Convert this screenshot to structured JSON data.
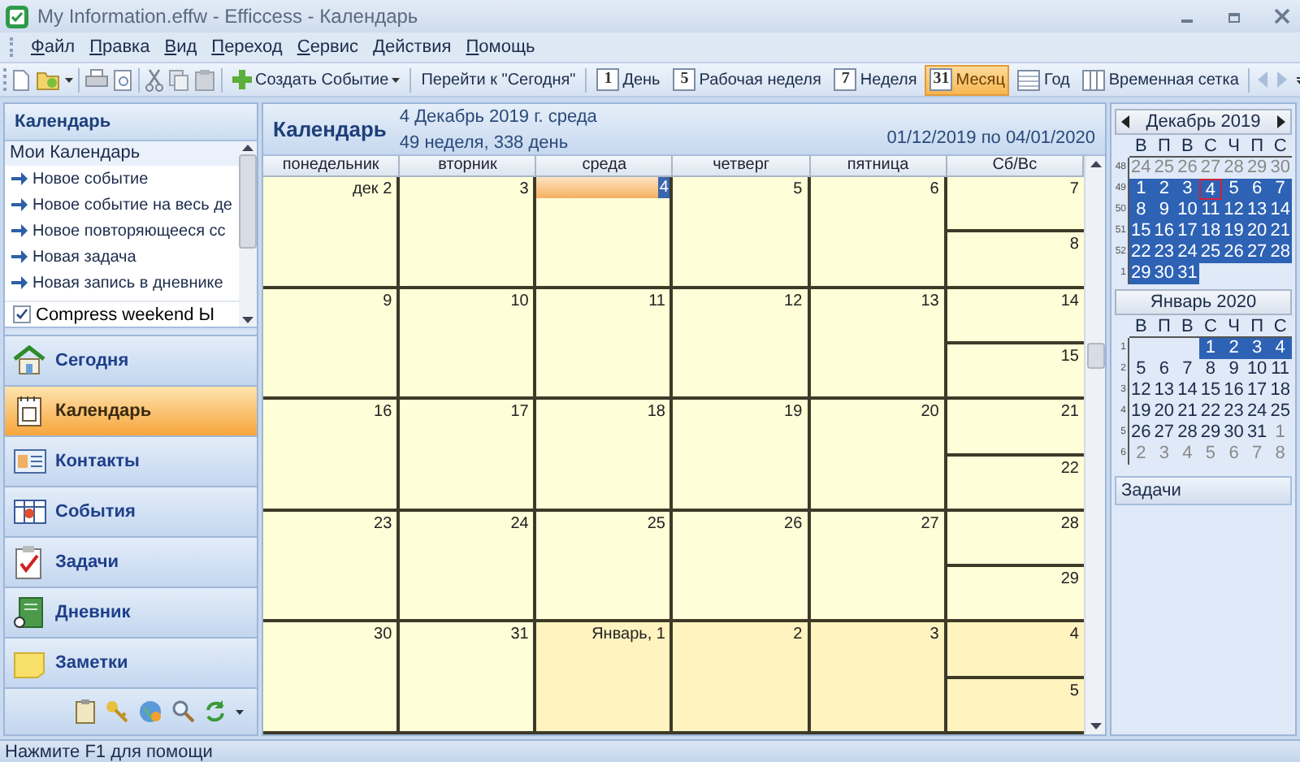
{
  "window": {
    "title": "My Information.effw - Efficcess - Календарь"
  },
  "menu": [
    "Файл",
    "Правка",
    "Вид",
    "Переход",
    "Сервис",
    "Действия",
    "Помощь"
  ],
  "toolbar": {
    "create_button": "Создать Событие",
    "today_button": "Перейти к \"Сегодня\"",
    "views": [
      {
        "label": "День",
        "icon_text": "1",
        "selected": false
      },
      {
        "label": "Рабочая неделя",
        "icon_text": "5",
        "selected": false
      },
      {
        "label": "Неделя",
        "icon_text": "7",
        "selected": false
      },
      {
        "label": "Месяц",
        "icon_text": "31",
        "selected": true
      },
      {
        "label": "Год",
        "selected": false
      },
      {
        "label": "Временная сетка",
        "selected": false
      }
    ]
  },
  "sidebar": {
    "title": "Календарь",
    "list_title": "Мои Календарь",
    "actions": [
      "Новое событие",
      "Новое событие на весь де",
      "Новое повторяющееся сс",
      "Новая задача",
      "Новая запись в дневнике"
    ],
    "option": {
      "label": "Compress weekend Ы",
      "checked": true
    },
    "nav": [
      {
        "label": "Сегодня",
        "kind": "home",
        "selected": false
      },
      {
        "label": "Календарь",
        "kind": "calendar",
        "selected": true
      },
      {
        "label": "Контакты",
        "kind": "contacts",
        "selected": false
      },
      {
        "label": "События",
        "kind": "events",
        "selected": false
      },
      {
        "label": "Задачи",
        "kind": "tasks",
        "selected": false
      },
      {
        "label": "Дневник",
        "kind": "diary",
        "selected": false
      },
      {
        "label": "Заметки",
        "kind": "notes",
        "selected": false
      }
    ]
  },
  "calendar": {
    "title": "Календарь",
    "date_line": "4 Декабрь 2019 г. среда",
    "week_line": "49 неделя, 338 день",
    "range": "01/12/2019 по 04/01/2020",
    "columns": [
      "понедельник",
      "вторник",
      "среда",
      "четверг",
      "пятница",
      "Сб/Вс"
    ],
    "weeks": [
      {
        "days": [
          {
            "label": "дек 2",
            "selected": false,
            "next_month": false
          },
          {
            "label": "3",
            "selected": false,
            "next_month": false
          },
          {
            "label": "4",
            "selected": true,
            "next_month": false
          },
          {
            "label": "5",
            "selected": false,
            "next_month": false
          },
          {
            "label": "6",
            "selected": false,
            "next_month": false
          }
        ],
        "weekend": [
          {
            "label": "7",
            "selected": false,
            "next_month": false
          },
          {
            "label": "8",
            "selected": false,
            "next_month": false
          }
        ]
      },
      {
        "days": [
          {
            "label": "9",
            "selected": false,
            "next_month": false
          },
          {
            "label": "10",
            "selected": false,
            "next_month": false
          },
          {
            "label": "11",
            "selected": false,
            "next_month": false
          },
          {
            "label": "12",
            "selected": false,
            "next_month": false
          },
          {
            "label": "13",
            "selected": false,
            "next_month": false
          }
        ],
        "weekend": [
          {
            "label": "14",
            "selected": false,
            "next_month": false
          },
          {
            "label": "15",
            "selected": false,
            "next_month": false
          }
        ]
      },
      {
        "days": [
          {
            "label": "16",
            "selected": false,
            "next_month": false
          },
          {
            "label": "17",
            "selected": false,
            "next_month": false
          },
          {
            "label": "18",
            "selected": false,
            "next_month": false
          },
          {
            "label": "19",
            "selected": false,
            "next_month": false
          },
          {
            "label": "20",
            "selected": false,
            "next_month": false
          }
        ],
        "weekend": [
          {
            "label": "21",
            "selected": false,
            "next_month": false
          },
          {
            "label": "22",
            "selected": false,
            "next_month": false
          }
        ]
      },
      {
        "days": [
          {
            "label": "23",
            "selected": false,
            "next_month": false
          },
          {
            "label": "24",
            "selected": false,
            "next_month": false
          },
          {
            "label": "25",
            "selected": false,
            "next_month": false
          },
          {
            "label": "26",
            "selected": false,
            "next_month": false
          },
          {
            "label": "27",
            "selected": false,
            "next_month": false
          }
        ],
        "weekend": [
          {
            "label": "28",
            "selected": false,
            "next_month": false
          },
          {
            "label": "29",
            "selected": false,
            "next_month": false
          }
        ]
      },
      {
        "days": [
          {
            "label": "30",
            "selected": false,
            "next_month": false
          },
          {
            "label": "31",
            "selected": false,
            "next_month": false
          },
          {
            "label": "Январь, 1",
            "selected": false,
            "next_month": true
          },
          {
            "label": "2",
            "selected": false,
            "next_month": true
          },
          {
            "label": "3",
            "selected": false,
            "next_month": true
          }
        ],
        "weekend": [
          {
            "label": "4",
            "selected": false,
            "next_month": true
          },
          {
            "label": "5",
            "selected": false,
            "next_month": true
          }
        ]
      }
    ]
  },
  "mini_calendars": [
    {
      "title": "Декабрь 2019",
      "arrows": true,
      "weekdays": [
        "В",
        "П",
        "В",
        "С",
        "Ч",
        "П",
        "С"
      ],
      "rows": [
        {
          "week": "48",
          "days": [
            {
              "label": "24",
              "selected": false,
              "other_month": true,
              "today": false
            },
            {
              "label": "25",
              "selected": false,
              "other_month": true,
              "today": false
            },
            {
              "label": "26",
              "selected": false,
              "other_month": true,
              "today": false
            },
            {
              "label": "27",
              "selected": false,
              "other_month": true,
              "today": false
            },
            {
              "label": "28",
              "selected": false,
              "other_month": true,
              "today": false
            },
            {
              "label": "29",
              "selected": false,
              "other_month": true,
              "today": false
            },
            {
              "label": "30",
              "selected": false,
              "other_month": true,
              "today": false
            }
          ]
        },
        {
          "week": "49",
          "days": [
            {
              "label": "1",
              "selected": true,
              "other_month": false,
              "today": false
            },
            {
              "label": "2",
              "selected": true,
              "other_month": false,
              "today": false
            },
            {
              "label": "3",
              "selected": true,
              "other_month": false,
              "today": false
            },
            {
              "label": "4",
              "selected": true,
              "other_month": false,
              "today": true
            },
            {
              "label": "5",
              "selected": true,
              "other_month": false,
              "today": false
            },
            {
              "label": "6",
              "selected": true,
              "other_month": false,
              "today": false
            },
            {
              "label": "7",
              "selected": true,
              "other_month": false,
              "today": false
            }
          ]
        },
        {
          "week": "50",
          "days": [
            {
              "label": "8",
              "selected": true,
              "other_month": false,
              "today": false
            },
            {
              "label": "9",
              "selected": true,
              "other_month": false,
              "today": false
            },
            {
              "label": "10",
              "selected": true,
              "other_month": false,
              "today": false
            },
            {
              "label": "11",
              "selected": true,
              "other_month": false,
              "today": false
            },
            {
              "label": "12",
              "selected": true,
              "other_month": false,
              "today": false
            },
            {
              "label": "13",
              "selected": true,
              "other_month": false,
              "today": false
            },
            {
              "label": "14",
              "selected": true,
              "other_month": false,
              "today": false
            }
          ]
        },
        {
          "week": "51",
          "days": [
            {
              "label": "15",
              "selected": true,
              "other_month": false,
              "today": false
            },
            {
              "label": "16",
              "selected": true,
              "other_month": false,
              "today": false
            },
            {
              "label": "17",
              "selected": true,
              "other_month": false,
              "today": false
            },
            {
              "label": "18",
              "selected": true,
              "other_month": false,
              "today": false
            },
            {
              "label": "19",
              "selected": true,
              "other_month": false,
              "today": false
            },
            {
              "label": "20",
              "selected": true,
              "other_month": false,
              "today": false
            },
            {
              "label": "21",
              "selected": true,
              "other_month": false,
              "today": false
            }
          ]
        },
        {
          "week": "52",
          "days": [
            {
              "label": "22",
              "selected": true,
              "other_month": false,
              "today": false
            },
            {
              "label": "23",
              "selected": true,
              "other_month": false,
              "today": false
            },
            {
              "label": "24",
              "selected": true,
              "other_month": false,
              "today": false
            },
            {
              "label": "25",
              "selected": true,
              "other_month": false,
              "today": false
            },
            {
              "label": "26",
              "selected": true,
              "other_month": false,
              "today": false
            },
            {
              "label": "27",
              "selected": true,
              "other_month": false,
              "today": false
            },
            {
              "label": "28",
              "selected": true,
              "other_month": false,
              "today": false
            }
          ]
        },
        {
          "week": "1",
          "days": [
            {
              "label": "29",
              "selected": true,
              "other_month": false,
              "today": false
            },
            {
              "label": "30",
              "selected": true,
              "other_month": false,
              "today": false
            },
            {
              "label": "31",
              "selected": true,
              "other_month": false,
              "today": false
            }
          ]
        }
      ]
    },
    {
      "title": "Январь 2020",
      "arrows": false,
      "weekdays": [
        "В",
        "П",
        "В",
        "С",
        "Ч",
        "П",
        "С"
      ],
      "rows": [
        {
          "week": "1",
          "days": [
            {
              "label": "1",
              "selected": true,
              "other_month": false,
              "today": false
            },
            {
              "label": "2",
              "selected": true,
              "other_month": false,
              "today": false
            },
            {
              "label": "3",
              "selected": true,
              "other_month": false,
              "today": false
            },
            {
              "label": "4",
              "selected": true,
              "other_month": false,
              "today": false
            }
          ]
        },
        {
          "week": "2",
          "days": [
            {
              "label": "5",
              "selected": false,
              "other_month": false,
              "today": false
            },
            {
              "label": "6",
              "selected": false,
              "other_month": false,
              "today": false
            },
            {
              "label": "7",
              "selected": false,
              "other_month": false,
              "today": false
            },
            {
              "label": "8",
              "selected": false,
              "other_month": false,
              "today": false
            },
            {
              "label": "9",
              "selected": false,
              "other_month": false,
              "today": false
            },
            {
              "label": "10",
              "selected": false,
              "other_month": false,
              "today": false
            },
            {
              "label": "11",
              "selected": false,
              "other_month": false,
              "today": false
            }
          ]
        },
        {
          "week": "3",
          "days": [
            {
              "label": "12",
              "selected": false,
              "other_month": false,
              "today": false
            },
            {
              "label": "13",
              "selected": false,
              "other_month": false,
              "today": false
            },
            {
              "label": "14",
              "selected": false,
              "other_month": false,
              "today": false
            },
            {
              "label": "15",
              "selected": false,
              "other_month": false,
              "today": false
            },
            {
              "label": "16",
              "selected": false,
              "other_month": false,
              "today": false
            },
            {
              "label": "17",
              "selected": false,
              "other_month": false,
              "today": false
            },
            {
              "label": "18",
              "selected": false,
              "other_month": false,
              "today": false
            }
          ]
        },
        {
          "week": "4",
          "days": [
            {
              "label": "19",
              "selected": false,
              "other_month": false,
              "today": false
            },
            {
              "label": "20",
              "selected": false,
              "other_month": false,
              "today": false
            },
            {
              "label": "21",
              "selected": false,
              "other_month": false,
              "today": false
            },
            {
              "label": "22",
              "selected": false,
              "other_month": false,
              "today": false
            },
            {
              "label": "23",
              "selected": false,
              "other_month": false,
              "today": false
            },
            {
              "label": "24",
              "selected": false,
              "other_month": false,
              "today": false
            },
            {
              "label": "25",
              "selected": false,
              "other_month": false,
              "today": false
            }
          ]
        },
        {
          "week": "5",
          "days": [
            {
              "label": "26",
              "selected": false,
              "other_month": false,
              "today": false
            },
            {
              "label": "27",
              "selected": false,
              "other_month": false,
              "today": false
            },
            {
              "label": "28",
              "selected": false,
              "other_month": false,
              "today": false
            },
            {
              "label": "29",
              "selected": false,
              "other_month": false,
              "today": false
            },
            {
              "label": "30",
              "selected": false,
              "other_month": false,
              "today": false
            },
            {
              "label": "31",
              "selected": false,
              "other_month": false,
              "today": false
            },
            {
              "label": "1",
              "selected": false,
              "other_month": true,
              "today": false
            }
          ]
        },
        {
          "week": "6",
          "days": [
            {
              "label": "2",
              "selected": false,
              "other_month": true,
              "today": false
            },
            {
              "label": "3",
              "selected": false,
              "other_month": true,
              "today": false
            },
            {
              "label": "4",
              "selected": false,
              "other_month": true,
              "today": false
            },
            {
              "label": "5",
              "selected": false,
              "other_month": true,
              "today": false
            },
            {
              "label": "6",
              "selected": false,
              "other_month": true,
              "today": false
            },
            {
              "label": "7",
              "selected": false,
              "other_month": true,
              "today": false
            },
            {
              "label": "8",
              "selected": false,
              "other_month": true,
              "today": false
            }
          ]
        }
      ]
    }
  ],
  "tasks_panel": {
    "title": "Задачи"
  },
  "status_bar": "Нажмите F1 для помощи"
}
